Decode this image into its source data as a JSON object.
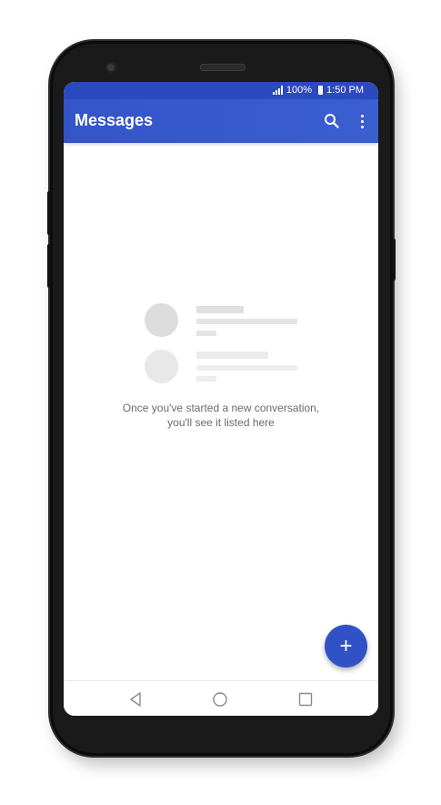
{
  "status_bar": {
    "battery": "100%",
    "time": "1:50 PM",
    "signal_icon": "signal-icon",
    "battery_icon": "battery-icon"
  },
  "app_bar": {
    "title": "Messages",
    "search_icon": "search-icon",
    "menu_icon": "more-vert-icon"
  },
  "empty_state": {
    "line1": "Once you've started a new conversation,",
    "line2": "you'll see it listed here"
  },
  "fab": {
    "label": "+",
    "icon": "add-icon"
  },
  "navigation": {
    "buttons": [
      "back-icon",
      "home-icon",
      "recents-icon"
    ]
  },
  "colors": {
    "accent": "#3152c6",
    "app_bar": "#3355c8",
    "status_bar": "#2b4ac0",
    "placeholder": "#e6e6e6",
    "text_muted": "#6b6b6b"
  }
}
